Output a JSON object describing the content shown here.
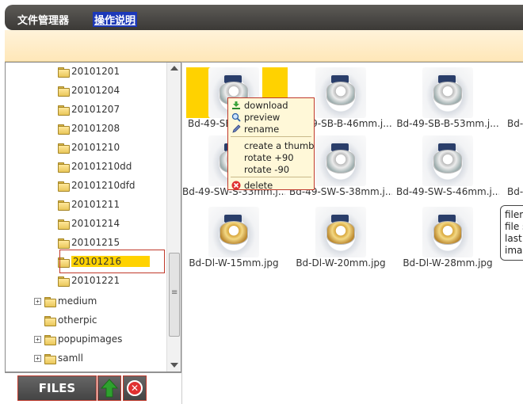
{
  "titlebar": {
    "app_title": "文件管理器",
    "help_link": "操作说明"
  },
  "tree": {
    "dates": [
      "20101201",
      "20101204",
      "20101207",
      "20101208",
      "20101210",
      "20101210dd",
      "20101210dfd",
      "20101211",
      "20101214",
      "20101215",
      "20101216",
      "20101221"
    ],
    "selected": "20101216",
    "groups": [
      "medium",
      "otherpic",
      "popupimages",
      "samll",
      "..."
    ]
  },
  "bottombar": {
    "files_label": "FILES"
  },
  "files": {
    "row1": [
      "Bd-49-SB-...",
      "Bd-49-SB-B-46mm.j...",
      "Bd-49-SB-B-53mm.j...",
      "Bd-4"
    ],
    "row2": [
      "Bd-49-SW-S-33mm.j...",
      "Bd-49-SW-S-38mm.j...",
      "Bd-49-SW-S-46mm.j...",
      "Bd-4"
    ],
    "row3": [
      "Bd-Dl-W-15mm.jpg",
      "Bd-Dl-W-20mm.jpg",
      "Bd-Dl-W-28mm.jpg"
    ]
  },
  "context_menu": {
    "download": "download",
    "preview": "preview",
    "rename": "rename",
    "create_thumb": "create a thumb",
    "rotate_plus": "rotate +90",
    "rotate_minus": "rotate -90",
    "delete": "delete"
  },
  "tooltip": {
    "line1": "filen",
    "line2": "file s",
    "line3": "last",
    "line4": "imag"
  },
  "colors": {
    "selection": "#ffd200",
    "highlight_border": "#c0392b",
    "menu_bg": "#fff8d8"
  }
}
